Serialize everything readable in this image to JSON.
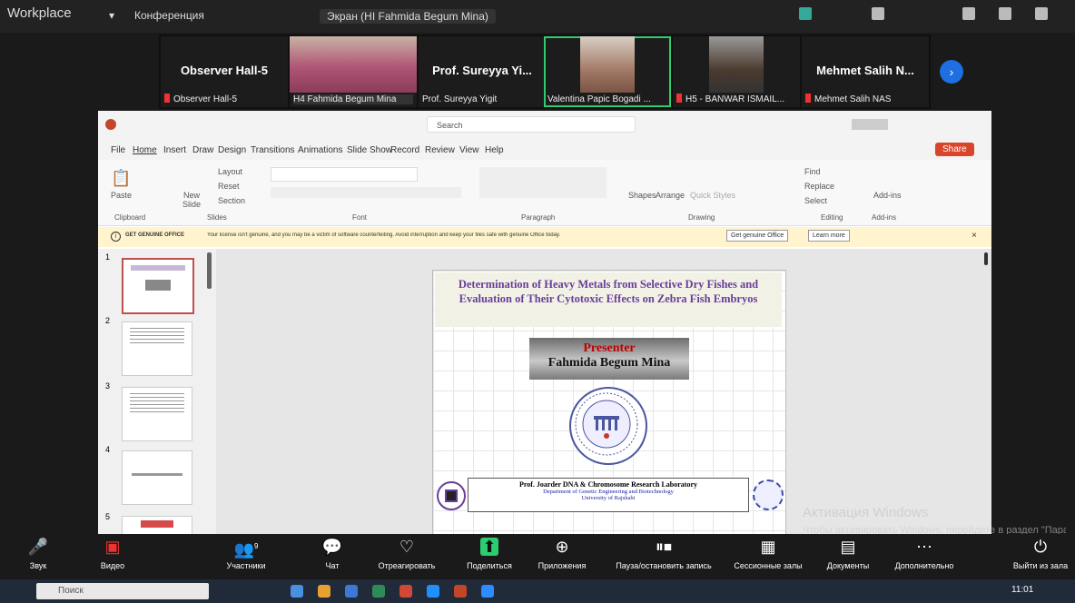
{
  "app": {
    "title": "Workplace",
    "meeting_label": "Конференция",
    "presenter_tab": "Экран (HI Fahmida Begum Mina)"
  },
  "gallery": [
    {
      "big": "Observer Hall-5",
      "small": "Observer Hall-5",
      "muted": true,
      "video": false
    },
    {
      "big": "",
      "small": "H4 Fahmida Begum Mina",
      "muted": false,
      "video": true
    },
    {
      "big": "Prof. Sureyya Yi...",
      "small": "Prof. Sureyya Yigit",
      "muted": false,
      "video": false
    },
    {
      "big": "",
      "small": "Valentina Papic Bogadi ...",
      "muted": false,
      "video": true,
      "active": true
    },
    {
      "big": "",
      "small": "H5 - BANWAR ISMAIL...",
      "muted": true,
      "video": true
    },
    {
      "big": "Mehmet Salih N...",
      "small": "Mehmet Salih NAS",
      "muted": true,
      "video": false
    }
  ],
  "ppt": {
    "search": "Search",
    "share": "Share",
    "menu": [
      "File",
      "Home",
      "Insert",
      "Draw",
      "Design",
      "Transitions",
      "Animations",
      "Slide Show",
      "Record",
      "Review",
      "View",
      "Help"
    ],
    "ribbon_groups": [
      "Clipboard",
      "Slides",
      "Font",
      "Paragraph",
      "Drawing",
      "Editing",
      "Add-ins"
    ],
    "ribbon_items": {
      "paste": "Paste",
      "new_slide": "New Slide",
      "layout": "Layout",
      "reset": "Reset",
      "section": "Section",
      "shapes": "Shapes",
      "arrange": "Arrange",
      "quick_styles": "Quick Styles",
      "find": "Find",
      "replace": "Replace",
      "select": "Select",
      "addins": "Add-ins"
    },
    "notice": {
      "label": "GET GENUINE OFFICE",
      "text": "Your license isn't genuine, and you may be a victim of software counterfeiting. Avoid interruption and keep your files safe with genuine Office today.",
      "btn1": "Get genuine Office",
      "btn2": "Learn more"
    },
    "thumb_numbers": [
      "1",
      "2",
      "3",
      "4",
      "5"
    ],
    "slide": {
      "title": "Determination of Heavy Metals from Selective Dry Fishes and Evaluation of Their Cytotoxic Effects on Zebra Fish Embryos",
      "presenter_label": "Presenter",
      "presenter_name": "Fahmida Begum Mina",
      "lab_title": "Prof. Joarder DNA & Chromosome Research Laboratory",
      "lab_dept": "Department of Genetic Engineering and Biotechnology",
      "lab_univ": "University of Rajshahi"
    }
  },
  "watermark": {
    "line1": "Активация Windows",
    "line2": "Чтобы активировать Windows, перейдите в раздел \"Параметры\"."
  },
  "toolbar": [
    {
      "label": "Звук",
      "icon": "🎤"
    },
    {
      "label": "Видео",
      "icon": "▣"
    },
    {
      "label": "Участники",
      "icon": "👥"
    },
    {
      "label": "Чат",
      "icon": "💬"
    },
    {
      "label": "Отреагировать",
      "icon": "♡"
    },
    {
      "label": "Поделиться",
      "icon": "⬆"
    },
    {
      "label": "Приложения",
      "icon": "⊕"
    },
    {
      "label": "Пауза/остановить запись",
      "icon": "⏸"
    },
    {
      "label": "Сессионные залы",
      "icon": "▦"
    },
    {
      "label": "Документы",
      "icon": "▤"
    },
    {
      "label": "Дополнительно",
      "icon": "⋯"
    },
    {
      "label": "Выйти из зала",
      "icon": "⏻"
    }
  ],
  "participants_count": "9",
  "taskbar": {
    "search": "Поиск",
    "time": "11:01"
  }
}
